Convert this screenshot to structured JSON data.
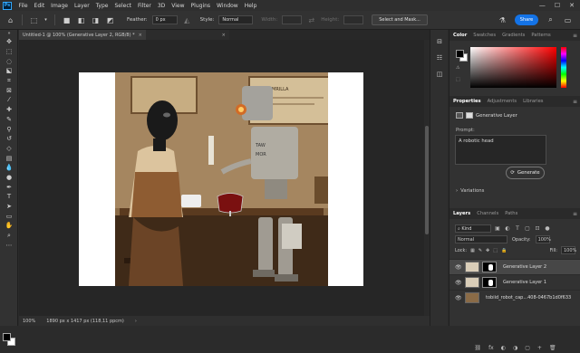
{
  "menubar": {
    "logo": "Ps",
    "items": [
      "File",
      "Edit",
      "Image",
      "Layer",
      "Type",
      "Select",
      "Filter",
      "3D",
      "View",
      "Plugins",
      "Window",
      "Help"
    ],
    "controls": [
      "—",
      "☐",
      "✕"
    ]
  },
  "options_bar": {
    "feather_label": "Feather:",
    "feather_value": "0 px",
    "style_label": "Style:",
    "style_value": "Normal",
    "width_label": "Width:",
    "height_label": "Height:",
    "select_mask_label": "Select and Mask...",
    "share_label": "Share"
  },
  "document": {
    "tab_title": "Untitled-1 @ 100% (Generative Layer 2, RGB/8) *",
    "close": "×",
    "inactive_tab_close": "×"
  },
  "statusbar": {
    "zoom": "100%",
    "info": "1890 px x 1417 px (118,11 ppcm)",
    "chevron": "›"
  },
  "artwork": {
    "sign_text_1": "HOOTIK MRILLA",
    "robot_text_1": "TAW",
    "robot_text_2": "MOR"
  },
  "color_panel": {
    "tabs": [
      "Color",
      "Swatches",
      "Gradients",
      "Patterns"
    ],
    "active_tab": "Color",
    "foreground": "#000000",
    "background": "#ffffff",
    "menu": "≡"
  },
  "properties_panel": {
    "tabs": [
      "Properties",
      "Adjustments",
      "Libraries"
    ],
    "layer_type": "Generative Layer",
    "prompt_label": "Prompt:",
    "prompt_value": "A robotic head",
    "generate_label": "Generate",
    "variations_label": "Variations",
    "menu": "≡"
  },
  "layers_panel": {
    "tabs": [
      "Layers",
      "Channels",
      "Paths"
    ],
    "filter_kind": "Kind",
    "blend_mode": "Normal",
    "opacity_label": "Opacity:",
    "opacity_value": "100%",
    "lock_label": "Lock:",
    "fill_label": "Fill:",
    "fill_value": "100%",
    "layers": [
      {
        "name": "Generative Layer 2",
        "selected": true
      },
      {
        "name": "Generative Layer 1",
        "selected": false
      },
      {
        "name": "tobiid_robot_cap...408-0467b1d0f633",
        "selected": false
      }
    ],
    "bottom_icons": [
      "⛓",
      "fx",
      "◐",
      "◑",
      "▢",
      "+",
      "🗑"
    ],
    "menu": "≡"
  },
  "colors": {
    "accent": "#1473e6",
    "panel_bg": "#323232",
    "canvas_bg": "#262626"
  }
}
